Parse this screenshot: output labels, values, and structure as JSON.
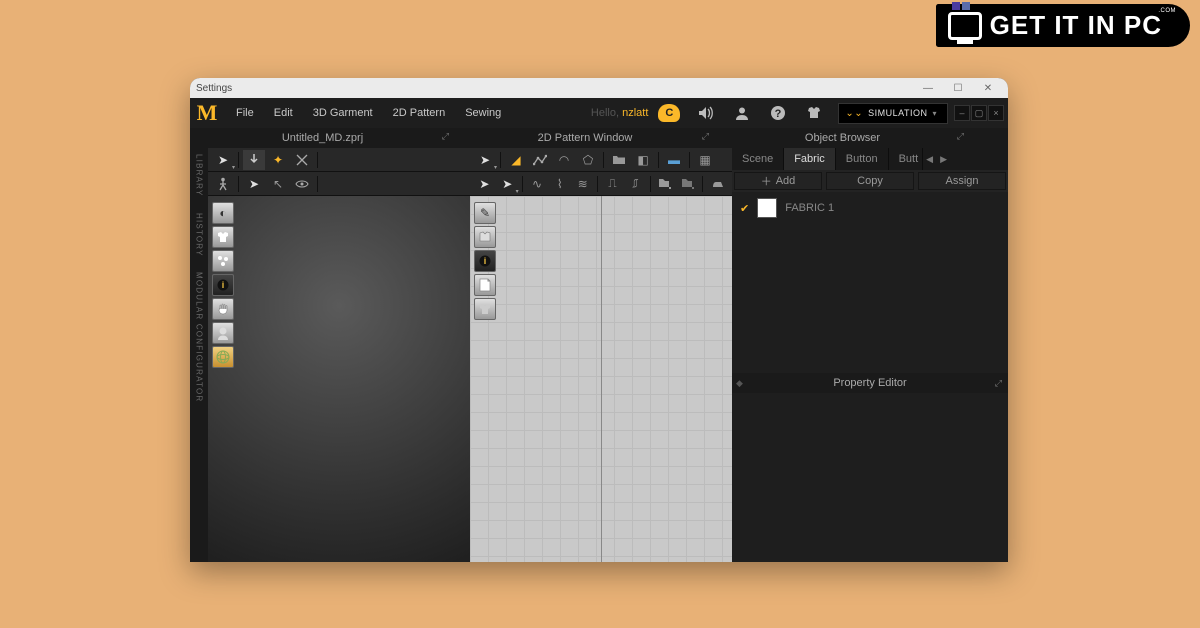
{
  "brand": {
    "text": "GET IT IN PC",
    "badge": ".COM"
  },
  "window": {
    "title": "Settings"
  },
  "menubar": {
    "logo": "M",
    "items": [
      "File",
      "Edit",
      "3D Garment",
      "2D Pattern",
      "Sewing"
    ],
    "hello_prefix": "Hello, ",
    "hello_user": "nzlatt",
    "simulation_label": "SIMULATION"
  },
  "panels": {
    "p3d": {
      "title": "Untitled_MD.zprj"
    },
    "p2d": {
      "title": "2D Pattern Window"
    },
    "browser": {
      "title": "Object Browser"
    }
  },
  "side_rail": {
    "labels": [
      "LIBRARY",
      "HISTORY",
      "MODULAR CONFIGURATOR"
    ]
  },
  "object_browser": {
    "tabs": [
      "Scene",
      "Fabric",
      "Button",
      "Butt"
    ],
    "active_tab_index": 1,
    "actions": {
      "add": "Add",
      "copy": "Copy",
      "assign": "Assign"
    },
    "items": [
      {
        "name": "FABRIC 1",
        "checked": true
      }
    ]
  },
  "property_editor": {
    "title": "Property Editor"
  },
  "toolbars": {
    "p3d_row1": [
      "cursor",
      "down-arrow",
      "move-gizmo",
      "rotate-gizmo"
    ],
    "p3d_row2": [
      "walk-figure",
      "cursor",
      "nav-arrow",
      "eye"
    ],
    "p2d_row1": [
      "cursor",
      "edge-orange",
      "polyline",
      "arc",
      "shape",
      "folder",
      "palette",
      "square",
      "grid"
    ],
    "p2d_row2": [
      "cursor",
      "cursor2",
      "seam1",
      "seam2",
      "seam3",
      "fold1",
      "fold2",
      "machine1",
      "machine2",
      "iron"
    ],
    "side_3d": [
      "surface",
      "garment",
      "particles",
      "info",
      "hand",
      "head",
      "wireframe"
    ],
    "side_2d": [
      "pencil",
      "add-pattern",
      "info-bubble",
      "note",
      "link"
    ]
  }
}
